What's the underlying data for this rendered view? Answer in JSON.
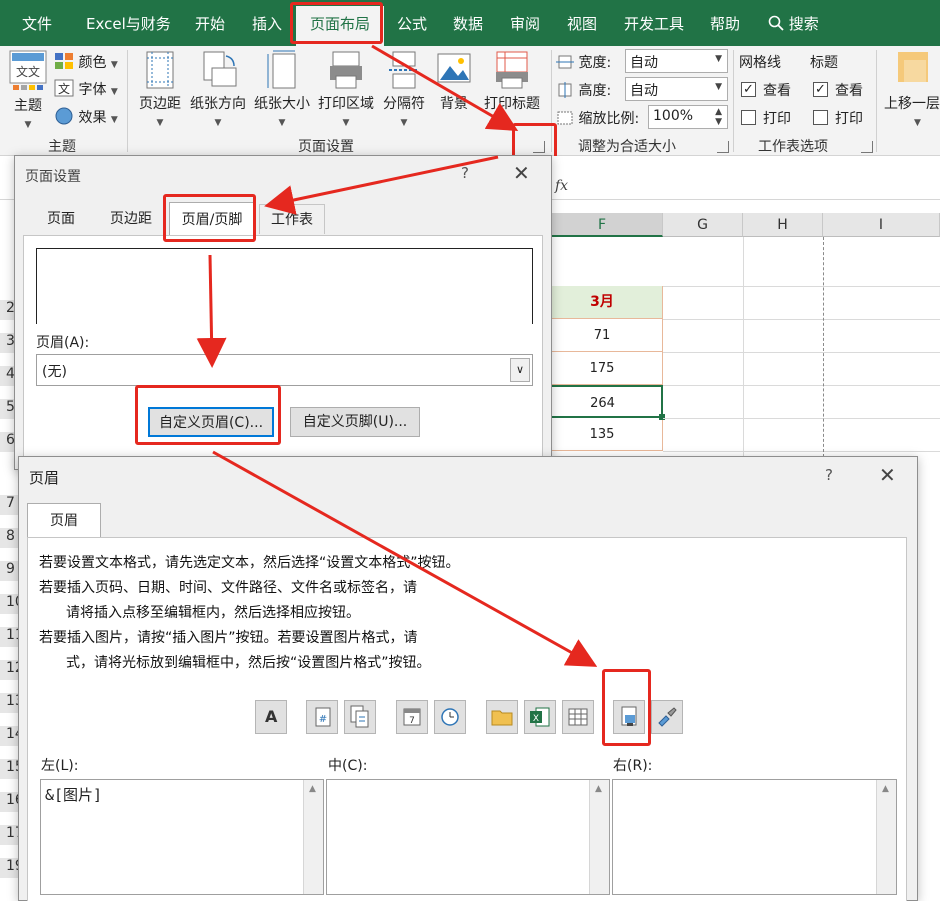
{
  "ribbon": {
    "tabs": [
      "文件",
      "Excel与财务",
      "开始",
      "插入",
      "页面布局",
      "公式",
      "数据",
      "审阅",
      "视图",
      "开发工具",
      "帮助"
    ],
    "active_tab": "页面布局",
    "search_label": "搜索",
    "theme_group": {
      "theme_label": "主题",
      "colors_label": "颜色",
      "fonts_label": "字体",
      "effects_label": "效果",
      "group_label": "主题"
    },
    "page_setup_group": {
      "margins_label": "页边距",
      "orientation_label": "纸张方向",
      "size_label": "纸张大小",
      "print_area_label": "打印区域",
      "breaks_label": "分隔符",
      "background_label": "背景",
      "print_titles_label": "打印标题",
      "group_label": "页面设置"
    },
    "scale_group": {
      "width_label": "宽度:",
      "width_value": "自动",
      "height_label": "高度:",
      "height_value": "自动",
      "scale_label": "缩放比例:",
      "scale_value": "100%",
      "group_label": "调整为合适大小"
    },
    "sheet_options_group": {
      "gridlines_label": "网格线",
      "headings_label": "标题",
      "view_label": "查看",
      "print_label": "打印",
      "group_label": "工作表选项"
    },
    "arrange_group": {
      "bring_forward_label": "上移一层"
    }
  },
  "sheet": {
    "columns": [
      "F",
      "G",
      "H",
      "I"
    ],
    "header_cell": "3月",
    "values": [
      "71",
      "175",
      "264",
      "135"
    ],
    "row_numbers": [
      "2",
      "3",
      "4",
      "5",
      "6",
      "7",
      "8",
      "9",
      "10",
      "11",
      "12",
      "13",
      "14",
      "15",
      "16",
      "17",
      "18",
      "19"
    ]
  },
  "page_setup_dialog": {
    "title": "页面设置",
    "help": "?",
    "close": "✕",
    "tabs": [
      "页面",
      "页边距",
      "页眉/页脚",
      "工作表"
    ],
    "active_tab": "页眉/页脚",
    "header_label": "页眉(A):",
    "header_value": "(无)",
    "custom_header_button": "自定义页眉(C)...",
    "custom_footer_button": "自定义页脚(U)..."
  },
  "header_dialog": {
    "title": "页眉",
    "help": "?",
    "close": "✕",
    "tab": "页眉",
    "instructions": [
      "若要设置文本格式，请先选定文本，然后选择“设置文本格式”按钮。",
      "若要插入页码、日期、时间、文件路径、文件名或标签名，请",
      "请将插入点移至编辑框内，然后选择相应按钮。",
      "若要插入图片，请按“插入图片”按钮。若要设置图片格式，请",
      "式，请将光标放到编辑框中，然后按“设置图片格式”按钮。"
    ],
    "toolbar": {
      "format_text_glyph": "A",
      "page_number_glyph": "#",
      "date_glyph": "7"
    },
    "left_label": "左(L):",
    "center_label": "中(C):",
    "right_label": "右(R):",
    "left_value": "&[图片]"
  },
  "colors": {
    "excel_green": "#217346",
    "highlight_red": "#e5281f",
    "header_cell_text": "#c00000",
    "header_cell_bg": "#e2efda"
  }
}
